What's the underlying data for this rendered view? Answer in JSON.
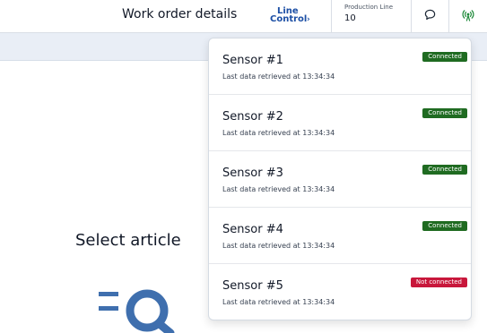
{
  "header": {
    "title": "Work order details",
    "logo": {
      "line1": "Line",
      "line2": "Control",
      "chevron": "›"
    },
    "production_line": {
      "label": "Production Line",
      "value": "10"
    },
    "chat_icon": "chat-bubble-icon",
    "signal_icon": "antenna-signal-icon"
  },
  "main": {
    "select_title": "Select article",
    "illustration_icon": "search-list-icon"
  },
  "colors": {
    "connected": "#1f6b21",
    "not_connected": "#c8173b",
    "signal": "#1f8a3a",
    "brand": "#1c4fa5"
  },
  "sensors": [
    {
      "name": "Sensor #1",
      "subtitle": "Last data retrieved at 13:34:34",
      "status": "Connected"
    },
    {
      "name": "Sensor #2",
      "subtitle": "Last data retrieved at 13:34:34",
      "status": "Connected"
    },
    {
      "name": "Sensor #3",
      "subtitle": "Last data retrieved at 13:34:34",
      "status": "Connected"
    },
    {
      "name": "Sensor #4",
      "subtitle": "Last data retrieved at 13:34:34",
      "status": "Connected"
    },
    {
      "name": "Sensor #5",
      "subtitle": "Last data retrieved at 13:34:34",
      "status": "Not connected"
    }
  ]
}
